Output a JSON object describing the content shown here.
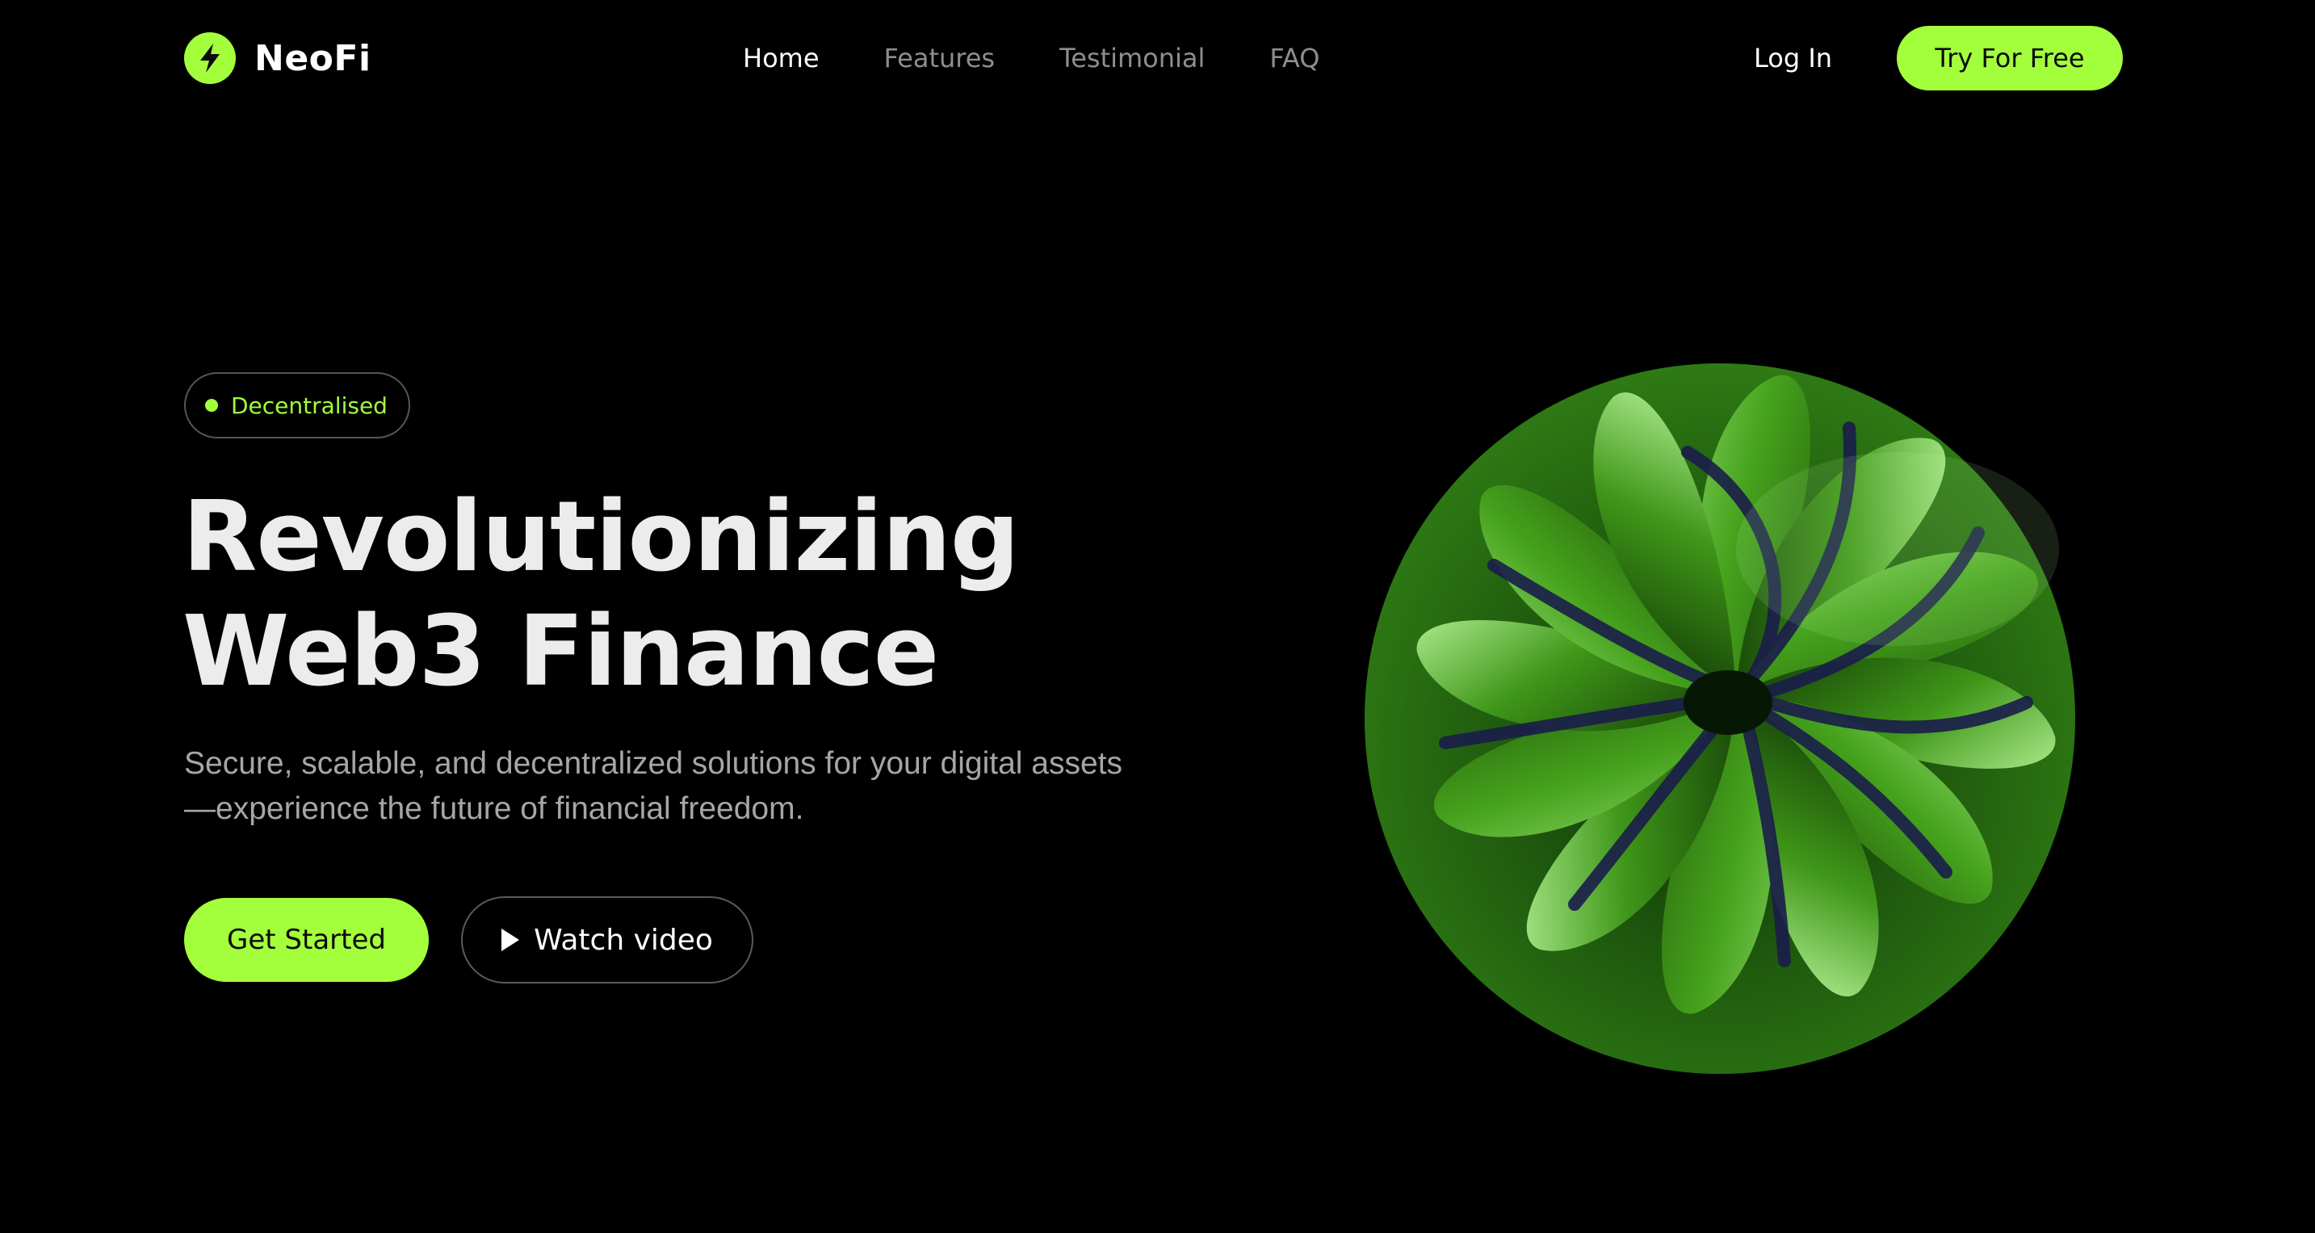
{
  "brand": {
    "name": "NeoFi",
    "accent_color": "#a3ff3b",
    "logo_icon": "lightning-bolt-icon"
  },
  "nav": {
    "links": [
      {
        "label": "Home",
        "active": true
      },
      {
        "label": "Features",
        "active": false
      },
      {
        "label": "Testimonial",
        "active": false
      },
      {
        "label": "FAQ",
        "active": false
      }
    ],
    "login_label": "Log In",
    "cta_label": "Try For Free"
  },
  "hero": {
    "badge": "Decentralised",
    "headline_line1": "Revolutionizing",
    "headline_line2": "Web3 Finance",
    "subtitle": "Secure, scalable, and decentralized solutions for your digital assets—experience the future of financial freedom.",
    "primary_cta": "Get Started",
    "secondary_cta": "Watch video",
    "secondary_icon": "play-icon",
    "art": "abstract-3d-green-swirl-sphere"
  }
}
